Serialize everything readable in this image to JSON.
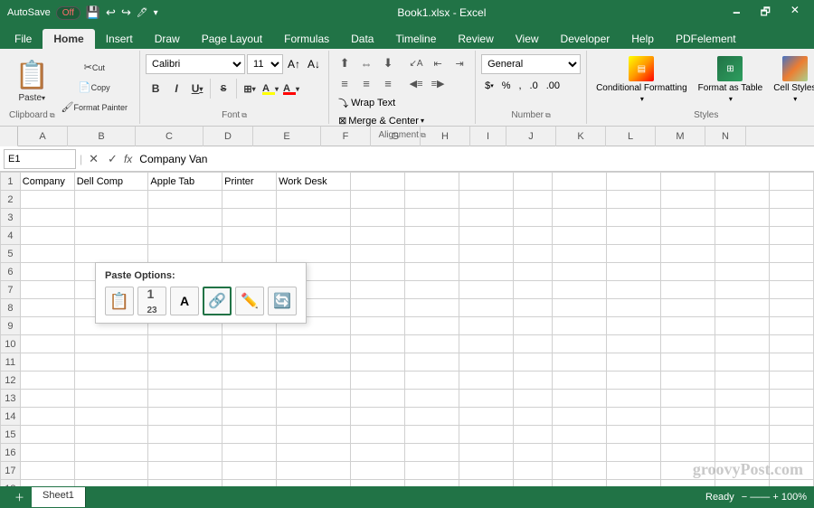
{
  "titleBar": {
    "autosave": "AutoSave",
    "autosaveState": "Off",
    "fileName": "Book1.xlsx",
    "appName": "Excel",
    "quickAccessIcons": [
      "save",
      "undo",
      "redo"
    ],
    "winButtons": [
      "minimize",
      "restore",
      "close"
    ]
  },
  "tabs": [
    {
      "label": "File",
      "active": false
    },
    {
      "label": "Home",
      "active": true
    },
    {
      "label": "Insert",
      "active": false
    },
    {
      "label": "Draw",
      "active": false
    },
    {
      "label": "Page Layout",
      "active": false
    },
    {
      "label": "Formulas",
      "active": false
    },
    {
      "label": "Data",
      "active": false
    },
    {
      "label": "Timeline",
      "active": false
    },
    {
      "label": "Review",
      "active": false
    },
    {
      "label": "View",
      "active": false
    },
    {
      "label": "Developer",
      "active": false
    },
    {
      "label": "Help",
      "active": false
    },
    {
      "label": "PDFelement",
      "active": false
    }
  ],
  "ribbon": {
    "groups": [
      {
        "name": "Clipboard",
        "buttons": [
          {
            "label": "Paste",
            "icon": "📋"
          },
          {
            "label": "Cut",
            "icon": "✂"
          },
          {
            "label": "Copy",
            "icon": "📄"
          },
          {
            "label": "Format Painter",
            "icon": "🖌"
          }
        ]
      },
      {
        "name": "Font",
        "fontName": "Calibri",
        "fontSize": "11",
        "bold": "B",
        "italic": "I",
        "underline": "U",
        "strikethrough": "S",
        "fontColor": "#FF0000",
        "highlightColor": "#FFFF00"
      },
      {
        "name": "Alignment",
        "wrapText": "Wrap Text",
        "mergeCenter": "Merge & Center"
      },
      {
        "name": "Number",
        "format": "General"
      },
      {
        "name": "Styles",
        "conditionalFormatting": "Conditional Formatting",
        "formatAsTable": "Format as Table",
        "cellStyles": "Cell Styles"
      }
    ]
  },
  "formulaBar": {
    "cellRef": "E1",
    "formula": "Company Van"
  },
  "grid": {
    "columns": [
      "A",
      "B",
      "C",
      "D",
      "E",
      "F",
      "G",
      "H",
      "I",
      "J",
      "K",
      "L",
      "M",
      "N"
    ],
    "rows": 18,
    "cells": {
      "A1": "Company",
      "B1": "Dell Comp",
      "C1": "Apple Tab",
      "D1": "Printer",
      "E1": "Work Desk"
    }
  },
  "pasteOptions": {
    "title": "Paste Options:",
    "options": [
      {
        "icon": "📋",
        "label": "Paste"
      },
      {
        "icon": "🔢",
        "label": "Values"
      },
      {
        "icon": "A",
        "label": "Formatting"
      },
      {
        "icon": "🔗",
        "label": "Link"
      },
      {
        "icon": "✏️",
        "label": "Picture"
      },
      {
        "icon": "🔄",
        "label": "Transpose"
      }
    ]
  },
  "bottomBar": {
    "sheets": [
      {
        "label": "Sheet1",
        "active": true
      }
    ],
    "status": "Ready",
    "zoomLevel": "100%"
  },
  "watermark": "groovyPost.com"
}
